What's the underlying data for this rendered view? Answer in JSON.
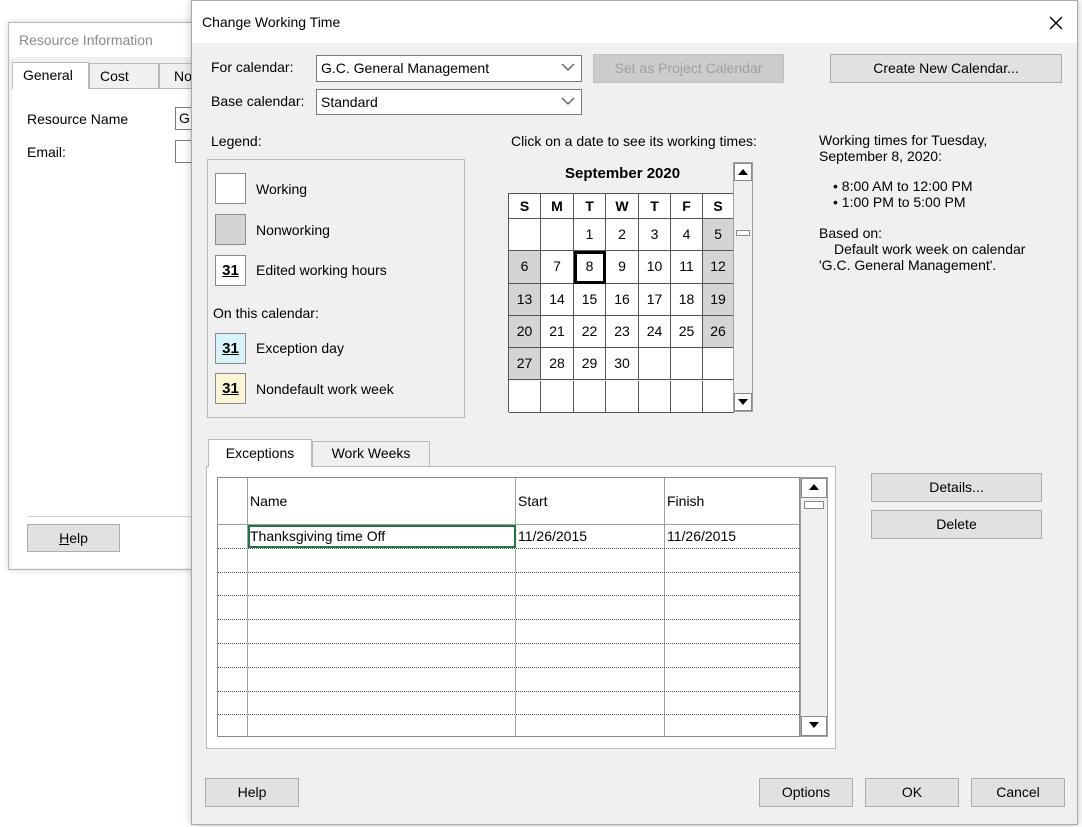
{
  "background_dialog": {
    "title": "Resource Information",
    "tabs": [
      "General",
      "Cost",
      "No"
    ],
    "resource_name_label": "Resource Name",
    "resource_name_value": "G.",
    "email_label": "Email:",
    "help_label": "Help",
    "help_mnemonic": "H",
    "help_rest": "elp"
  },
  "dialog": {
    "title": "Change Working Time",
    "for_calendar_label": "For calendar:",
    "for_calendar_value": "G.C. General Management",
    "base_calendar_label": "Base calendar:",
    "base_calendar_value": "Standard",
    "set_project_calendar_label": "Set as Project Calendar",
    "create_new_calendar_label": "Create New Calendar...",
    "legend": {
      "title": "Legend:",
      "working": "Working",
      "nonworking": "Nonworking",
      "edited_hours": "Edited working hours",
      "on_this_calendar": "On this calendar:",
      "exception_day": "Exception day",
      "nondefault_week": "Nondefault work week",
      "swatch_number": "31",
      "colors": {
        "exception": "#d8f4fb",
        "nondefault": "#fdf6d6",
        "nonworking": "#d4d4d4"
      }
    },
    "calendar": {
      "instruction": "Click on a date to see its working times:",
      "month_title": "September 2020",
      "weekdays": [
        "S",
        "M",
        "T",
        "W",
        "T",
        "F",
        "S"
      ],
      "weeks": [
        [
          "",
          "",
          "1",
          "2",
          "3",
          "4",
          "5"
        ],
        [
          "6",
          "7",
          "8",
          "9",
          "10",
          "11",
          "12"
        ],
        [
          "13",
          "14",
          "15",
          "16",
          "17",
          "18",
          "19"
        ],
        [
          "20",
          "21",
          "22",
          "23",
          "24",
          "25",
          "26"
        ],
        [
          "27",
          "28",
          "29",
          "30",
          "",
          "",
          ""
        ],
        [
          "",
          "",
          "",
          "",
          "",
          "",
          ""
        ]
      ],
      "selected_day": "8"
    },
    "working_times": {
      "heading": "Working times for Tuesday, September 8, 2020:",
      "ranges": [
        "• 8:00 AM to 12:00 PM",
        "• 1:00 PM to 5:00 PM"
      ],
      "based_on_label": "Based on:",
      "based_on_line1": "Default work week on calendar",
      "based_on_line2": "'G.C. General Management'."
    },
    "tabs": {
      "exceptions": "Exceptions",
      "work_weeks": "Work Weeks"
    },
    "grid": {
      "columns": [
        "Name",
        "Start",
        "Finish"
      ],
      "rows": [
        {
          "name": "Thanksgiving time Off",
          "start": "11/26/2015",
          "finish": "11/26/2015"
        }
      ]
    },
    "details_label": "Details...",
    "delete_label": "Delete",
    "help_label": "Help",
    "options_label": "Options",
    "ok_label": "OK",
    "cancel_label": "Cancel"
  }
}
